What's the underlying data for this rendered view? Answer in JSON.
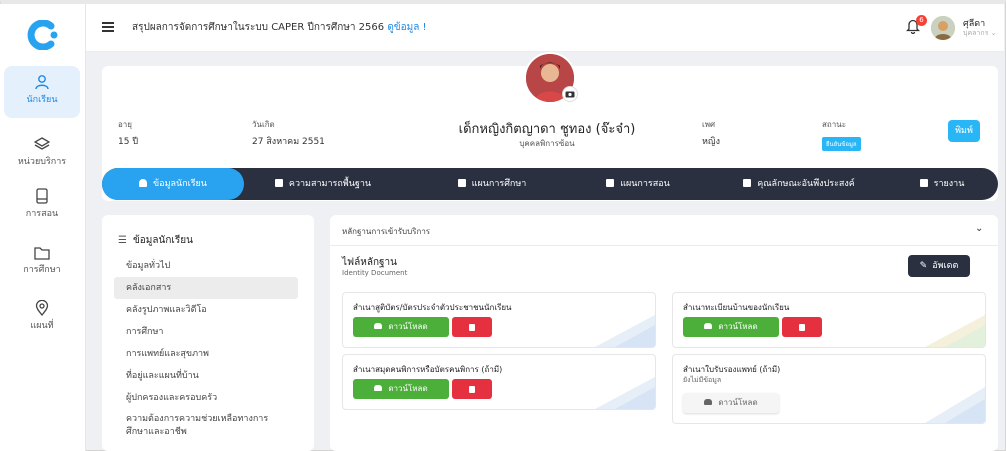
{
  "topbar": {
    "title": "สรุปผลการจัดการศึกษาในระบบ CAPER ปีการศึกษา 2566",
    "link": "ดูข้อมูล !",
    "notification_count": "6",
    "user_name": "ศุลีดา",
    "user_role": "บุคลากร ⌄"
  },
  "nav": [
    {
      "label": "นักเรียน",
      "icon": "person-icon"
    },
    {
      "label": "หน่วยบริการ",
      "icon": "layers-icon"
    },
    {
      "label": "การสอน",
      "icon": "tablet-icon"
    },
    {
      "label": "การศึกษา",
      "icon": "folder-icon"
    },
    {
      "label": "แผนที่",
      "icon": "location-pin-icon"
    }
  ],
  "profile": {
    "age_label": "อายุ",
    "age_value": "15 ปี",
    "birth_label": "วันเกิด",
    "birth_value": "27 สิงหาคม 2551",
    "name": "เด็กหญิงกิตญาดา ชูทอง (จ๊ะจ๋า)",
    "subtitle": "บุคคลพิการซ้อน",
    "sex_label": "เพศ",
    "sex_value": "หญิง",
    "status_label": "สถานะ",
    "status_value": "ยืนยันข้อมูล",
    "print_button": "พิมพ์"
  },
  "tabs": [
    {
      "label": "ข้อมูลนักเรียน",
      "active": true
    },
    {
      "label": "ความสามารถพื้นฐาน",
      "active": false
    },
    {
      "label": "แผนการศึกษา",
      "active": false
    },
    {
      "label": "แผนการสอน",
      "active": false
    },
    {
      "label": "คุณลักษณะอันพึงประสงค์",
      "active": false
    },
    {
      "label": "รายงาน",
      "active": false
    }
  ],
  "menu": {
    "title": "ข้อมูลนักเรียน",
    "items": [
      "ข้อมูลทั่วไป",
      "คลังเอกสาร",
      "คลังรูปภาพและวิดีโอ",
      "การศึกษา",
      "การแพทย์และสุขภาพ",
      "ที่อยู่และแผนที่บ้าน",
      "ผู้ปกครองและครอบครัว",
      "ความต้องการความช่วยเหลือทางการ",
      "ศึกษาและอาชีพ"
    ]
  },
  "main": {
    "section_header": "หลักฐานการเข้ารับบริการ",
    "files_title": "ไฟล์หลักฐาน",
    "files_subtitle": "Identity Document",
    "update_button": "อัพเดต",
    "download_label": "ดาวน์โหลด",
    "documents": [
      {
        "title": "สำเนาสูติบัตร/บัตรประจำตัวประชาชนนักเรียน",
        "has_file": true
      },
      {
        "title": "สำเนาทะเบียนบ้านของนักเรียน",
        "has_file": true
      },
      {
        "title": "สำเนาสมุดคนพิการหรือบัตรคนพิการ (ถ้ามี)",
        "has_file": true
      },
      {
        "title": "สำเนาใบรับรองแพทย์ (ถ้ามี)",
        "has_file": false,
        "empty_text": "ยังไม่มีข้อมูล"
      }
    ]
  },
  "colors": {
    "accent": "#29a3f0",
    "dark": "#2b3040",
    "success": "#4caf3a",
    "danger": "#e53040"
  }
}
